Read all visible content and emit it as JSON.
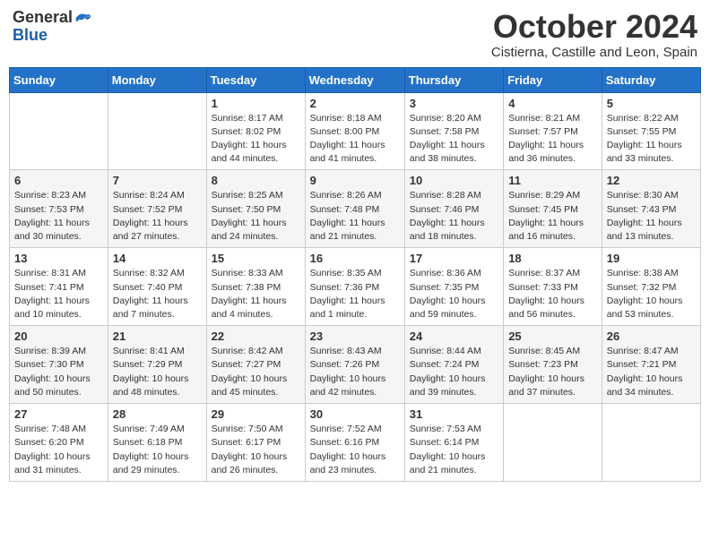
{
  "header": {
    "logo_general": "General",
    "logo_blue": "Blue",
    "month": "October 2024",
    "location": "Cistierna, Castille and Leon, Spain"
  },
  "weekdays": [
    "Sunday",
    "Monday",
    "Tuesday",
    "Wednesday",
    "Thursday",
    "Friday",
    "Saturday"
  ],
  "weeks": [
    [
      {
        "day": "",
        "detail": ""
      },
      {
        "day": "",
        "detail": ""
      },
      {
        "day": "1",
        "detail": "Sunrise: 8:17 AM\nSunset: 8:02 PM\nDaylight: 11 hours and 44 minutes."
      },
      {
        "day": "2",
        "detail": "Sunrise: 8:18 AM\nSunset: 8:00 PM\nDaylight: 11 hours and 41 minutes."
      },
      {
        "day": "3",
        "detail": "Sunrise: 8:20 AM\nSunset: 7:58 PM\nDaylight: 11 hours and 38 minutes."
      },
      {
        "day": "4",
        "detail": "Sunrise: 8:21 AM\nSunset: 7:57 PM\nDaylight: 11 hours and 36 minutes."
      },
      {
        "day": "5",
        "detail": "Sunrise: 8:22 AM\nSunset: 7:55 PM\nDaylight: 11 hours and 33 minutes."
      }
    ],
    [
      {
        "day": "6",
        "detail": "Sunrise: 8:23 AM\nSunset: 7:53 PM\nDaylight: 11 hours and 30 minutes."
      },
      {
        "day": "7",
        "detail": "Sunrise: 8:24 AM\nSunset: 7:52 PM\nDaylight: 11 hours and 27 minutes."
      },
      {
        "day": "8",
        "detail": "Sunrise: 8:25 AM\nSunset: 7:50 PM\nDaylight: 11 hours and 24 minutes."
      },
      {
        "day": "9",
        "detail": "Sunrise: 8:26 AM\nSunset: 7:48 PM\nDaylight: 11 hours and 21 minutes."
      },
      {
        "day": "10",
        "detail": "Sunrise: 8:28 AM\nSunset: 7:46 PM\nDaylight: 11 hours and 18 minutes."
      },
      {
        "day": "11",
        "detail": "Sunrise: 8:29 AM\nSunset: 7:45 PM\nDaylight: 11 hours and 16 minutes."
      },
      {
        "day": "12",
        "detail": "Sunrise: 8:30 AM\nSunset: 7:43 PM\nDaylight: 11 hours and 13 minutes."
      }
    ],
    [
      {
        "day": "13",
        "detail": "Sunrise: 8:31 AM\nSunset: 7:41 PM\nDaylight: 11 hours and 10 minutes."
      },
      {
        "day": "14",
        "detail": "Sunrise: 8:32 AM\nSunset: 7:40 PM\nDaylight: 11 hours and 7 minutes."
      },
      {
        "day": "15",
        "detail": "Sunrise: 8:33 AM\nSunset: 7:38 PM\nDaylight: 11 hours and 4 minutes."
      },
      {
        "day": "16",
        "detail": "Sunrise: 8:35 AM\nSunset: 7:36 PM\nDaylight: 11 hours and 1 minute."
      },
      {
        "day": "17",
        "detail": "Sunrise: 8:36 AM\nSunset: 7:35 PM\nDaylight: 10 hours and 59 minutes."
      },
      {
        "day": "18",
        "detail": "Sunrise: 8:37 AM\nSunset: 7:33 PM\nDaylight: 10 hours and 56 minutes."
      },
      {
        "day": "19",
        "detail": "Sunrise: 8:38 AM\nSunset: 7:32 PM\nDaylight: 10 hours and 53 minutes."
      }
    ],
    [
      {
        "day": "20",
        "detail": "Sunrise: 8:39 AM\nSunset: 7:30 PM\nDaylight: 10 hours and 50 minutes."
      },
      {
        "day": "21",
        "detail": "Sunrise: 8:41 AM\nSunset: 7:29 PM\nDaylight: 10 hours and 48 minutes."
      },
      {
        "day": "22",
        "detail": "Sunrise: 8:42 AM\nSunset: 7:27 PM\nDaylight: 10 hours and 45 minutes."
      },
      {
        "day": "23",
        "detail": "Sunrise: 8:43 AM\nSunset: 7:26 PM\nDaylight: 10 hours and 42 minutes."
      },
      {
        "day": "24",
        "detail": "Sunrise: 8:44 AM\nSunset: 7:24 PM\nDaylight: 10 hours and 39 minutes."
      },
      {
        "day": "25",
        "detail": "Sunrise: 8:45 AM\nSunset: 7:23 PM\nDaylight: 10 hours and 37 minutes."
      },
      {
        "day": "26",
        "detail": "Sunrise: 8:47 AM\nSunset: 7:21 PM\nDaylight: 10 hours and 34 minutes."
      }
    ],
    [
      {
        "day": "27",
        "detail": "Sunrise: 7:48 AM\nSunset: 6:20 PM\nDaylight: 10 hours and 31 minutes."
      },
      {
        "day": "28",
        "detail": "Sunrise: 7:49 AM\nSunset: 6:18 PM\nDaylight: 10 hours and 29 minutes."
      },
      {
        "day": "29",
        "detail": "Sunrise: 7:50 AM\nSunset: 6:17 PM\nDaylight: 10 hours and 26 minutes."
      },
      {
        "day": "30",
        "detail": "Sunrise: 7:52 AM\nSunset: 6:16 PM\nDaylight: 10 hours and 23 minutes."
      },
      {
        "day": "31",
        "detail": "Sunrise: 7:53 AM\nSunset: 6:14 PM\nDaylight: 10 hours and 21 minutes."
      },
      {
        "day": "",
        "detail": ""
      },
      {
        "day": "",
        "detail": ""
      }
    ]
  ]
}
